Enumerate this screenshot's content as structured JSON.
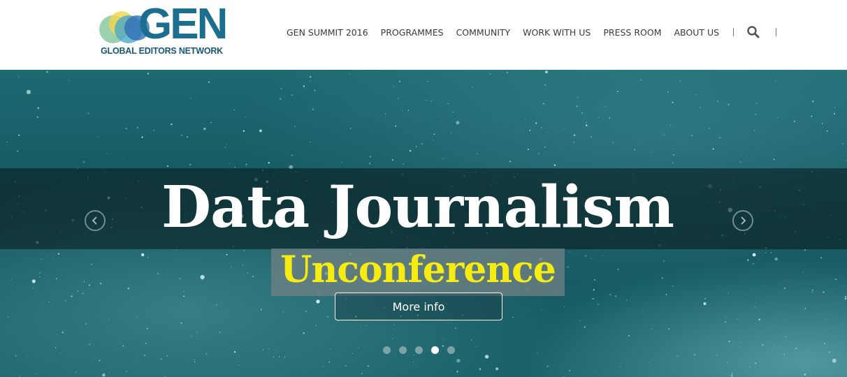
{
  "logo": {
    "name": "GEN",
    "subtitle": "GLOBAL EDITORS NETWORK"
  },
  "nav": {
    "items": [
      {
        "label": "GEN SUMMIT 2016"
      },
      {
        "label": "PROGRAMMES"
      },
      {
        "label": "COMMUNITY"
      },
      {
        "label": "WORK WITH US"
      },
      {
        "label": "PRESS ROOM"
      },
      {
        "label": "ABOUT US"
      }
    ],
    "search_icon": "search-icon"
  },
  "hero": {
    "title": "Data Journalism",
    "subtitle": "Unconference",
    "button_label": "More info",
    "prev_icon": "chevron-left-icon",
    "next_icon": "chevron-right-icon",
    "slide_count": 5,
    "active_slide": 4
  },
  "colors": {
    "logo_blue": "#1c6e8f",
    "hero_teal": "#14555e",
    "subtitle_yellow": "#f7ec12",
    "nav_text": "#3a3a3a"
  }
}
